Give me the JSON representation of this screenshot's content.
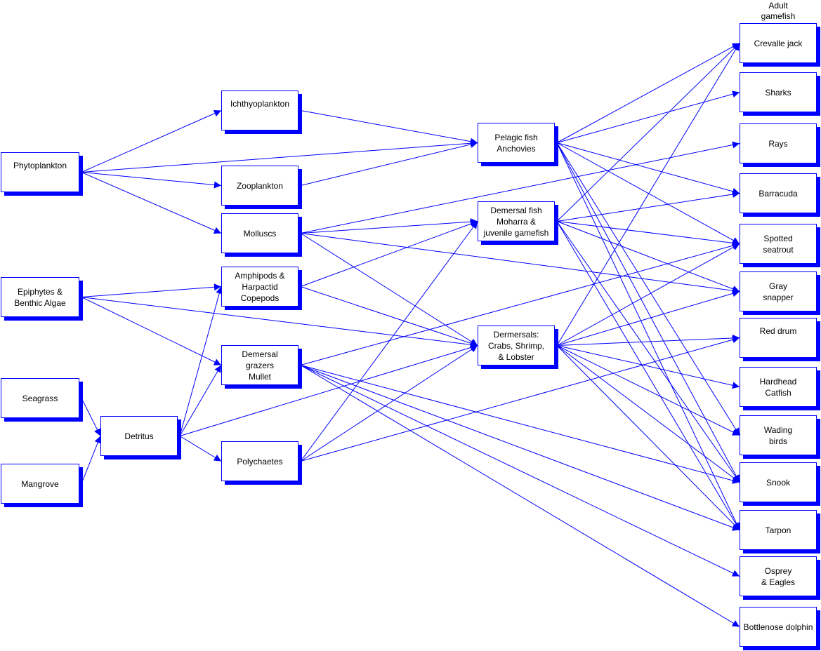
{
  "header_label": [
    "Adult",
    "gamefish"
  ],
  "colors": {
    "edge": "#0000ff",
    "box_border": "#0000ff",
    "box_shadow": "#0000ff"
  },
  "nodes": [
    {
      "id": "phytoplankton",
      "label": [
        "Phytoplankton"
      ]
    },
    {
      "id": "epiphytes",
      "label": [
        "Epiphytes &",
        "Benthic Algae"
      ]
    },
    {
      "id": "seagrass",
      "label": [
        "Seagrass"
      ]
    },
    {
      "id": "mangrove",
      "label": [
        "Mangrove"
      ]
    },
    {
      "id": "detritus",
      "label": [
        "Detritus"
      ]
    },
    {
      "id": "ichthyoplankton",
      "label": [
        "Ichthyoplankton"
      ]
    },
    {
      "id": "zooplankton",
      "label": [
        "Zooplankton"
      ]
    },
    {
      "id": "molluscs",
      "label": [
        "Molluscs"
      ]
    },
    {
      "id": "amphipods",
      "label": [
        "Amphipods &",
        "Harpactid",
        "Copepods"
      ]
    },
    {
      "id": "grazers",
      "label": [
        "Demersal",
        "grazers",
        "Mullet"
      ]
    },
    {
      "id": "polychaetes",
      "label": [
        "Polychaetes"
      ]
    },
    {
      "id": "pelagic",
      "label": [
        "Pelagic fish",
        "Anchovies"
      ]
    },
    {
      "id": "demfish",
      "label": [
        "Demersal fish",
        "Moharra &",
        "juvenile gamefish"
      ]
    },
    {
      "id": "crabs",
      "label": [
        "Dermersals:",
        "Crabs,  Shrimp,",
        "& Lobster"
      ]
    },
    {
      "id": "crevalle",
      "label": [
        "Crevalle jack"
      ]
    },
    {
      "id": "sharks",
      "label": [
        "Sharks"
      ]
    },
    {
      "id": "rays",
      "label": [
        "Rays"
      ]
    },
    {
      "id": "barracuda",
      "label": [
        "Barracuda"
      ]
    },
    {
      "id": "seatrout",
      "label": [
        "Spotted",
        "seatrout"
      ]
    },
    {
      "id": "snapper",
      "label": [
        "Gray",
        "snapper"
      ]
    },
    {
      "id": "reddrum",
      "label": [
        "Red drum"
      ]
    },
    {
      "id": "catfish",
      "label": [
        "Hardhead",
        "Catfish"
      ]
    },
    {
      "id": "wading",
      "label": [
        "Wading",
        "birds"
      ]
    },
    {
      "id": "snook",
      "label": [
        "Snook"
      ]
    },
    {
      "id": "tarpon",
      "label": [
        "Tarpon"
      ]
    },
    {
      "id": "osprey",
      "label": [
        "Osprey",
        "& Eagles"
      ]
    },
    {
      "id": "dolphin",
      "label": [
        "Bottlenose dolphin"
      ]
    }
  ],
  "edges": [
    [
      "phytoplankton",
      "ichthyoplankton"
    ],
    [
      "phytoplankton",
      "zooplankton"
    ],
    [
      "phytoplankton",
      "molluscs"
    ],
    [
      "phytoplankton",
      "pelagic"
    ],
    [
      "ichthyoplankton",
      "pelagic"
    ],
    [
      "zooplankton",
      "pelagic"
    ],
    [
      "epiphytes",
      "amphipods"
    ],
    [
      "epiphytes",
      "grazers"
    ],
    [
      "epiphytes",
      "crabs"
    ],
    [
      "seagrass",
      "detritus"
    ],
    [
      "mangrove",
      "detritus"
    ],
    [
      "detritus",
      "amphipods"
    ],
    [
      "detritus",
      "grazers"
    ],
    [
      "detritus",
      "polychaetes"
    ],
    [
      "detritus",
      "crabs"
    ],
    [
      "molluscs",
      "demfish"
    ],
    [
      "molluscs",
      "rays"
    ],
    [
      "molluscs",
      "snapper"
    ],
    [
      "molluscs",
      "crabs"
    ],
    [
      "amphipods",
      "demfish"
    ],
    [
      "amphipods",
      "crabs"
    ],
    [
      "grazers",
      "seatrout"
    ],
    [
      "grazers",
      "snook"
    ],
    [
      "grazers",
      "tarpon"
    ],
    [
      "grazers",
      "osprey"
    ],
    [
      "grazers",
      "dolphin"
    ],
    [
      "polychaetes",
      "demfish"
    ],
    [
      "polychaetes",
      "crabs"
    ],
    [
      "polychaetes",
      "reddrum"
    ],
    [
      "pelagic",
      "crevalle"
    ],
    [
      "pelagic",
      "sharks"
    ],
    [
      "pelagic",
      "barracuda"
    ],
    [
      "pelagic",
      "seatrout"
    ],
    [
      "pelagic",
      "wading"
    ],
    [
      "pelagic",
      "snook"
    ],
    [
      "pelagic",
      "tarpon"
    ],
    [
      "demfish",
      "crevalle"
    ],
    [
      "demfish",
      "barracuda"
    ],
    [
      "demfish",
      "seatrout"
    ],
    [
      "demfish",
      "snapper"
    ],
    [
      "demfish",
      "snook"
    ],
    [
      "demfish",
      "tarpon"
    ],
    [
      "crabs",
      "crevalle"
    ],
    [
      "crabs",
      "seatrout"
    ],
    [
      "crabs",
      "snapper"
    ],
    [
      "crabs",
      "reddrum"
    ],
    [
      "crabs",
      "catfish"
    ],
    [
      "crabs",
      "wading"
    ],
    [
      "crabs",
      "snook"
    ],
    [
      "crabs",
      "tarpon"
    ]
  ]
}
